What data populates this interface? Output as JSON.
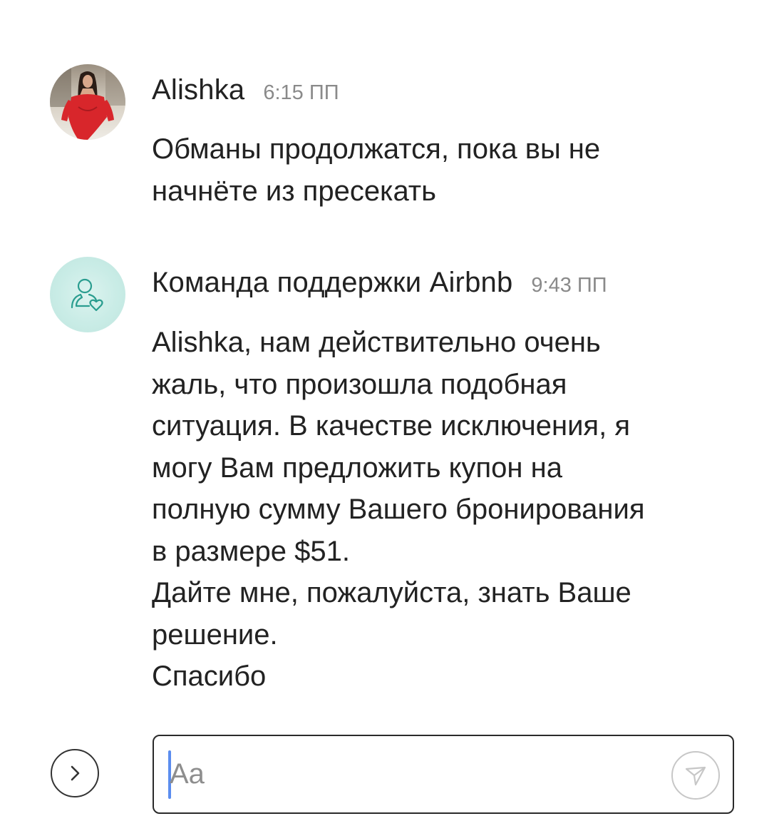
{
  "messages": [
    {
      "sender": "Alishka",
      "time": "6:15 ПП",
      "avatar_icon": "user-photo-avatar",
      "lines": [
        "Обманы продолжатся, пока вы не",
        "начнёте из пресекать"
      ]
    },
    {
      "sender": "Команда поддержки Airbnb",
      "time": "9:43 ПП",
      "avatar_icon": "support-heart-person-icon",
      "lines": [
        "Alishka, нам действительно очень",
        "жаль, что произошла подобная",
        "ситуация. В качестве исключения, я",
        "могу Вам предложить купон на",
        "полную сумму Вашего бронирования",
        "в размере $51.",
        "Дайте мне, пожалуйста, знать Ваше",
        "решение.",
        "Спасибо"
      ]
    }
  ],
  "composer": {
    "placeholder": "Aa",
    "value": "",
    "expand_icon": "chevron-right-icon",
    "send_icon": "send-icon"
  },
  "colors": {
    "text": "#222222",
    "time": "#8a8a8a",
    "support_avatar_bg": "#c9ece6",
    "support_icon": "#2a9d8f",
    "caret": "#5b8def"
  }
}
